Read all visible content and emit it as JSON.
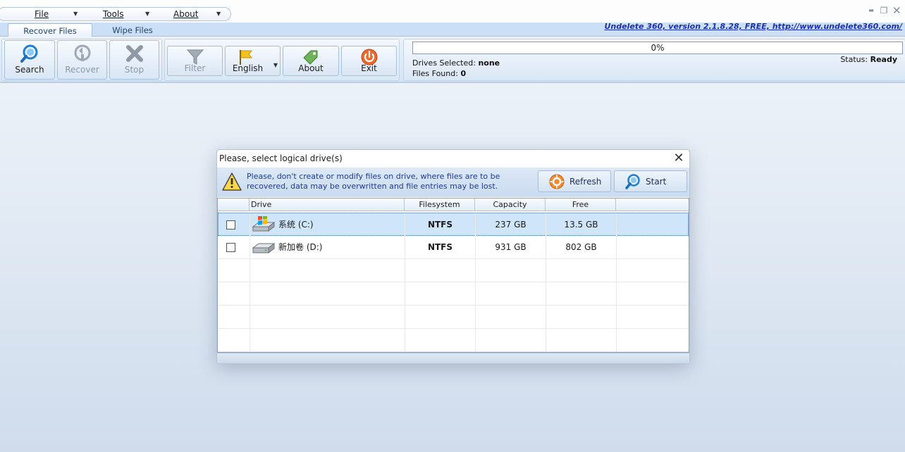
{
  "menu": {
    "items": [
      {
        "label": "File"
      },
      {
        "label": "Tools"
      },
      {
        "label": "About"
      }
    ]
  },
  "window_controls": {
    "minimize": "▬",
    "maximize": "❐",
    "close": "✕"
  },
  "tabs": [
    {
      "label": "Recover Files",
      "active": true
    },
    {
      "label": "Wipe Files",
      "active": false
    }
  ],
  "version_link": "Undelete 360, version 2.1.8.28, FREE, http://www.undelete360.com/",
  "ribbon": {
    "search": "Search",
    "recover": "Recover",
    "stop": "Stop",
    "filter": "Filter",
    "language": "English",
    "about": "About",
    "exit": "Exit"
  },
  "progress": {
    "value": 0,
    "label": "0%"
  },
  "drives_selected": {
    "label": "Drives Selected:",
    "value": "none"
  },
  "files_found": {
    "label": "Files Found:",
    "value": "0"
  },
  "status": {
    "label": "Status:",
    "value": "Ready"
  },
  "dialog": {
    "title": "Please, select logical drive(s)",
    "warning_line1": "Please, don't create or modify files on drive, where files are to be",
    "warning_line2": "recovered, data may be overwritten and file entries may be lost.",
    "refresh_label": "Refresh",
    "start_label": "Start",
    "columns": [
      "Drive",
      "Filesystem",
      "Capacity",
      "Free"
    ],
    "drives": [
      {
        "name": "系统 (C:)",
        "filesystem": "NTFS",
        "capacity": "237 GB",
        "free": "13.5 GB",
        "checked": false,
        "selected": true,
        "icon": "windows-drive-icon"
      },
      {
        "name": "新加卷 (D:)",
        "filesystem": "NTFS",
        "capacity": "931 GB",
        "free": "802 GB",
        "checked": false,
        "selected": false,
        "icon": "hard-drive-icon"
      }
    ]
  },
  "colors": {
    "accent": "#1e3b8f",
    "link": "#1b2fb0",
    "selection": "#cfe5fa",
    "tabstrip": "#cbe0f7"
  }
}
